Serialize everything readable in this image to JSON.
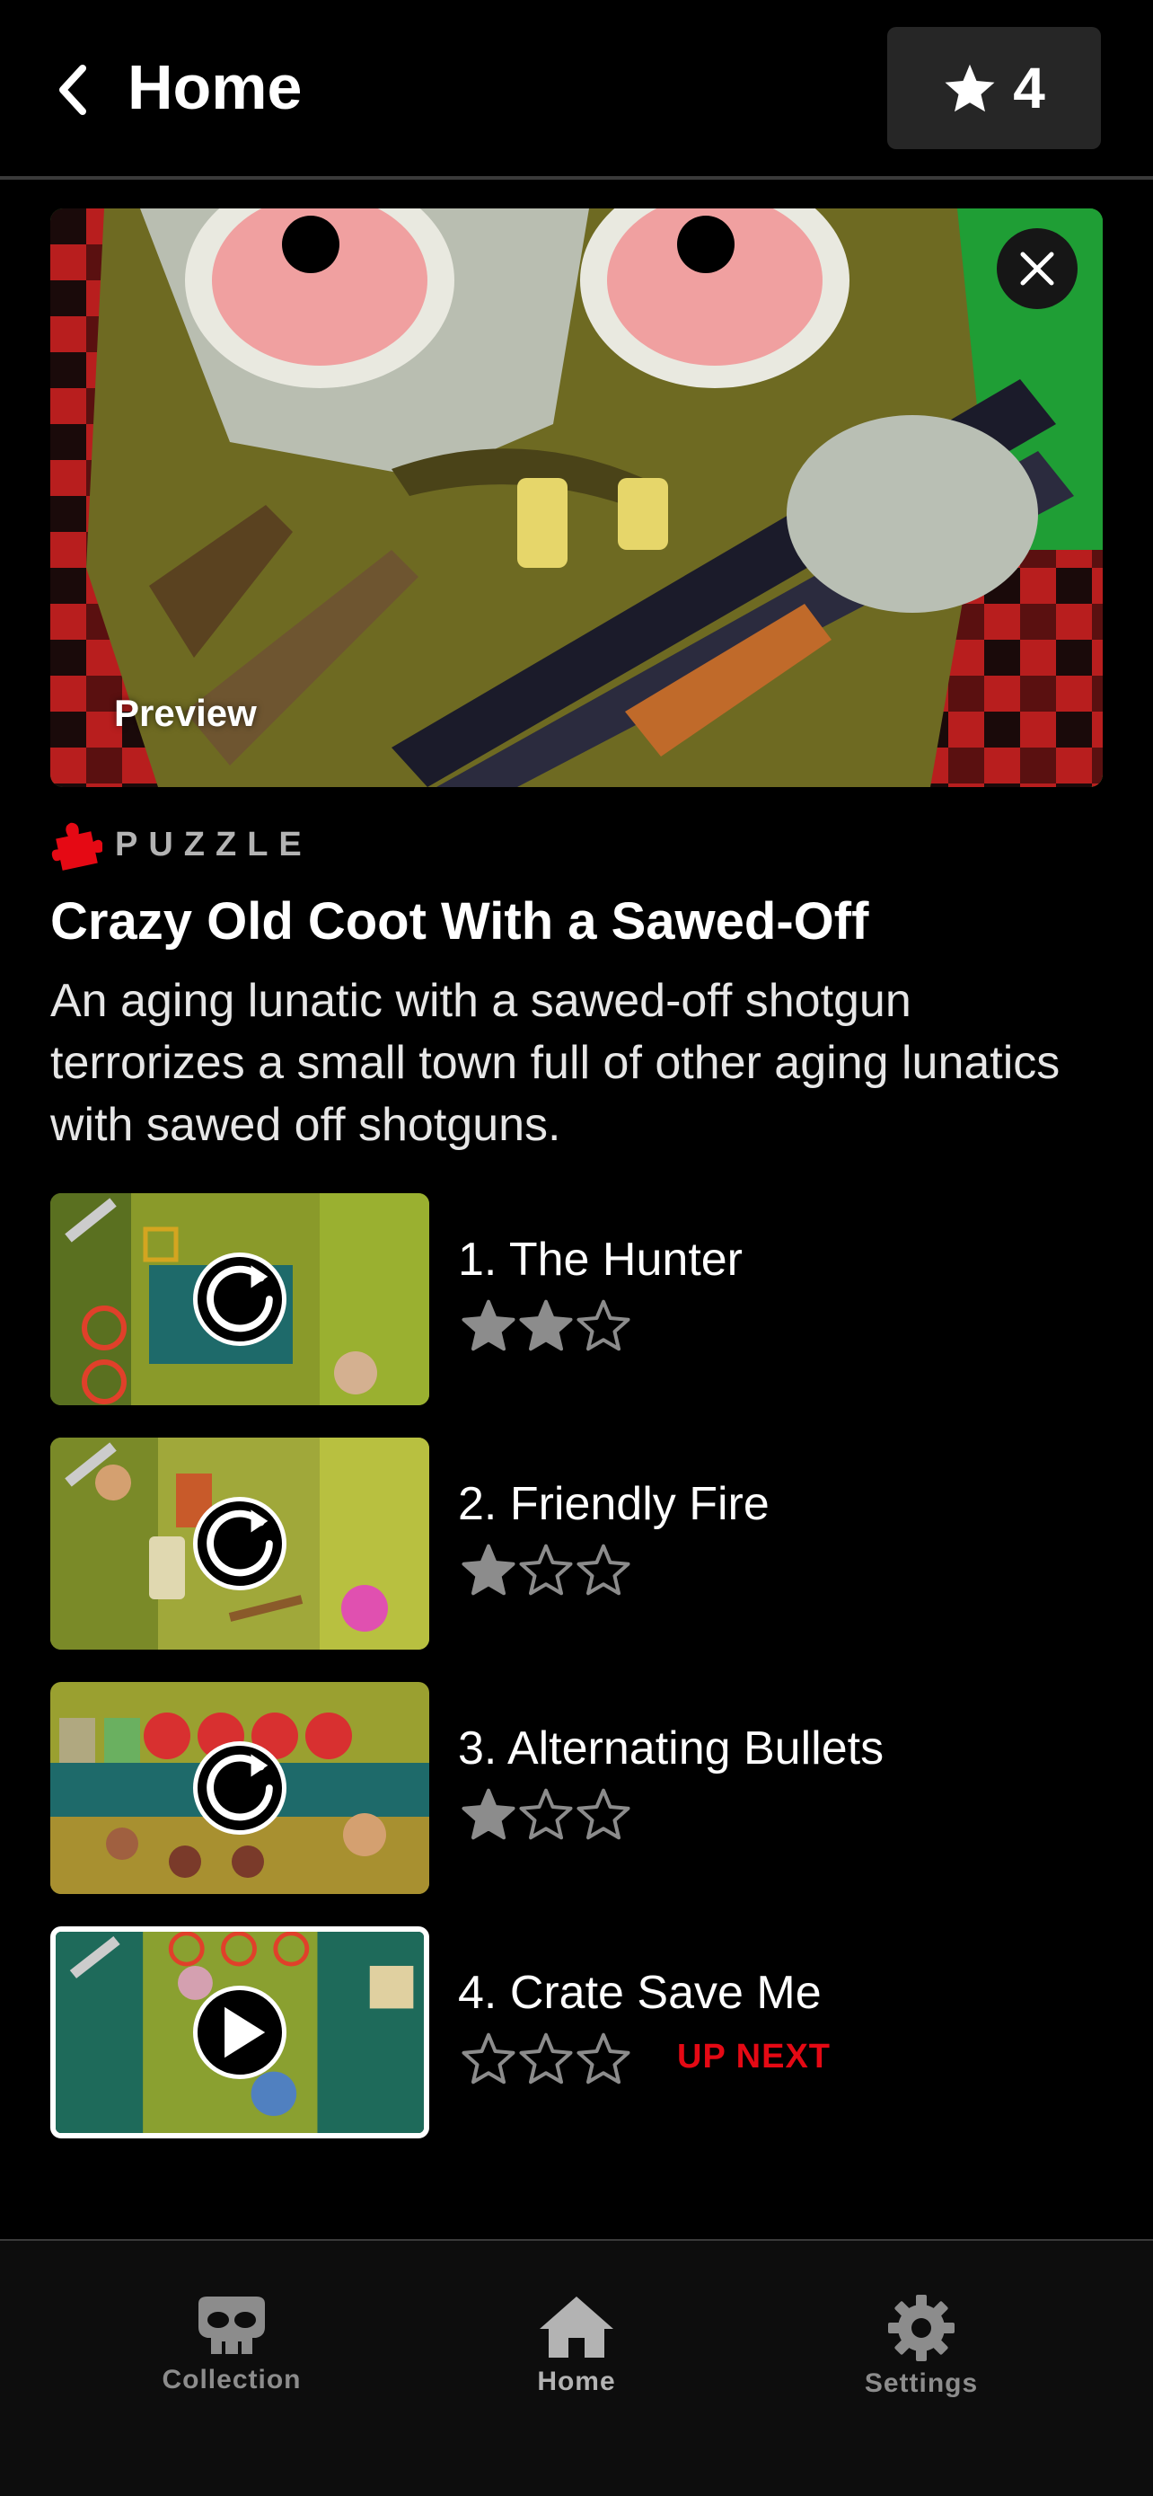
{
  "header": {
    "back_icon": "chevron-left-icon",
    "title": "Home",
    "star_icon": "star-icon",
    "star_count": "4"
  },
  "hero": {
    "preview_label": "Preview",
    "close_icon": "close-icon"
  },
  "game": {
    "genre_icon": "puzzle-piece-icon",
    "genre": "PUZZLE",
    "title": "Crazy Old Coot With a Sawed-Off",
    "description": "An aging lunatic with a sawed-off shotgun terrorizes a small town full of other aging lunatics with sawed off shotguns."
  },
  "levels": [
    {
      "name": "1. The Hunter",
      "stars_earned": 2,
      "stars_total": 3,
      "action_icon": "replay-icon"
    },
    {
      "name": "2. Friendly Fire",
      "stars_earned": 1,
      "stars_total": 3,
      "action_icon": "replay-icon"
    },
    {
      "name": "3. Alternating Bullets",
      "stars_earned": 1,
      "stars_total": 3,
      "action_icon": "replay-icon"
    },
    {
      "name": "4. Crate Save Me",
      "stars_earned": 0,
      "stars_total": 3,
      "action_icon": "play-icon",
      "badge": "UP NEXT"
    }
  ],
  "tabs": [
    {
      "label": "Collection",
      "icon": "skull-icon",
      "active": false
    },
    {
      "label": "Home",
      "icon": "home-icon",
      "active": true
    },
    {
      "label": "Settings",
      "icon": "gear-icon",
      "active": false
    }
  ],
  "colors": {
    "accent_red": "#e50914",
    "background": "#000000",
    "star_filled": "#8c8c8c"
  }
}
